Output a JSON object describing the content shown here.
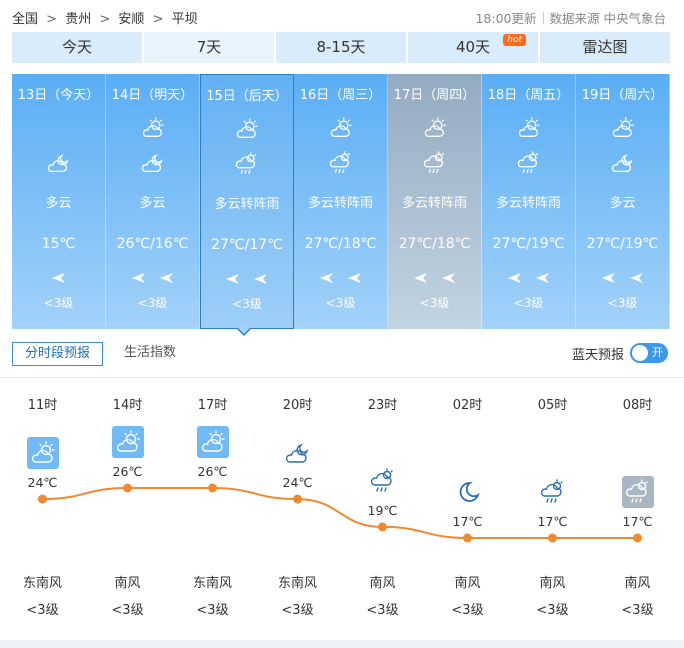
{
  "breadcrumb": {
    "items": [
      "全国",
      "贵州",
      "安顺",
      "平坝"
    ],
    "separator": ">"
  },
  "header": {
    "update_time": "18:00更新",
    "source": "数据来源 中央气象台"
  },
  "tabs": [
    {
      "label": "今天"
    },
    {
      "label": "7天"
    },
    {
      "label": "8-15天"
    },
    {
      "label": "40天",
      "badge": "hot"
    },
    {
      "label": "雷达图"
    }
  ],
  "days": [
    {
      "date": "13日（今天）",
      "icon_day": "",
      "icon_night": "partly-cloudy-night-icon",
      "condition": "多云",
      "temp": "15℃",
      "winds": 1,
      "wind_level": "<3级"
    },
    {
      "date": "14日（明天）",
      "icon_day": "partly-cloudy-icon",
      "icon_night": "partly-cloudy-night-icon",
      "condition": "多云",
      "temp": "26℃/16℃",
      "winds": 2,
      "wind_level": "<3级"
    },
    {
      "date": "15日（后天）",
      "icon_day": "partly-cloudy-icon",
      "icon_night": "shower-icon",
      "condition": "多云转阵雨",
      "temp": "27℃/17℃",
      "winds": 2,
      "wind_level": "<3级"
    },
    {
      "date": "16日（周三）",
      "icon_day": "partly-cloudy-icon",
      "icon_night": "shower-icon",
      "condition": "多云转阵雨",
      "temp": "27℃/18℃",
      "winds": 2,
      "wind_level": "<3级"
    },
    {
      "date": "17日（周四）",
      "icon_day": "partly-cloudy-icon",
      "icon_night": "shower-icon",
      "condition": "多云转阵雨",
      "temp": "27℃/18℃",
      "winds": 2,
      "wind_level": "<3级"
    },
    {
      "date": "18日（周五）",
      "icon_day": "partly-cloudy-icon",
      "icon_night": "shower-icon",
      "condition": "多云转阵雨",
      "temp": "27℃/19℃",
      "winds": 2,
      "wind_level": "<3级"
    },
    {
      "date": "19日（周六）",
      "icon_day": "partly-cloudy-icon",
      "icon_night": "partly-cloudy-night-icon",
      "condition": "多云",
      "temp": "27℃/19℃",
      "winds": 2,
      "wind_level": "<3级"
    }
  ],
  "subtabs": {
    "active": "分时段预报",
    "other": "生活指数"
  },
  "blue_sky": {
    "label": "蓝天预报",
    "toggle": "开"
  },
  "hourly": [
    {
      "time": "11时",
      "icon": "partly-cloudy-icon",
      "temp": "24℃",
      "temp_value": 24,
      "wind_dir": "东南风",
      "wind_level": "<3级"
    },
    {
      "time": "14时",
      "icon": "partly-cloudy-icon",
      "temp": "26℃",
      "temp_value": 26,
      "wind_dir": "南风",
      "wind_level": "<3级"
    },
    {
      "time": "17时",
      "icon": "partly-cloudy-icon",
      "temp": "26℃",
      "temp_value": 26,
      "wind_dir": "东南风",
      "wind_level": "<3级"
    },
    {
      "time": "20时",
      "icon": "partly-cloudy-night-icon",
      "temp": "24℃",
      "temp_value": 24,
      "wind_dir": "东南风",
      "wind_level": "<3级"
    },
    {
      "time": "23时",
      "icon": "shower-icon",
      "temp": "19℃",
      "temp_value": 19,
      "wind_dir": "南风",
      "wind_level": "<3级"
    },
    {
      "time": "02时",
      "icon": "moon-icon",
      "temp": "17℃",
      "temp_value": 17,
      "wind_dir": "南风",
      "wind_level": "<3级"
    },
    {
      "time": "05时",
      "icon": "shower-icon",
      "temp": "17℃",
      "temp_value": 17,
      "wind_dir": "南风",
      "wind_level": "<3级"
    },
    {
      "time": "08时",
      "icon": "shower-icon",
      "temp": "17℃",
      "temp_value": 17,
      "wind_dir": "南风",
      "wind_level": "<3级"
    }
  ],
  "colors": {
    "accent": "#3d97ea",
    "curve": "#f0892f",
    "hot_badge": "#ff6a1a"
  }
}
